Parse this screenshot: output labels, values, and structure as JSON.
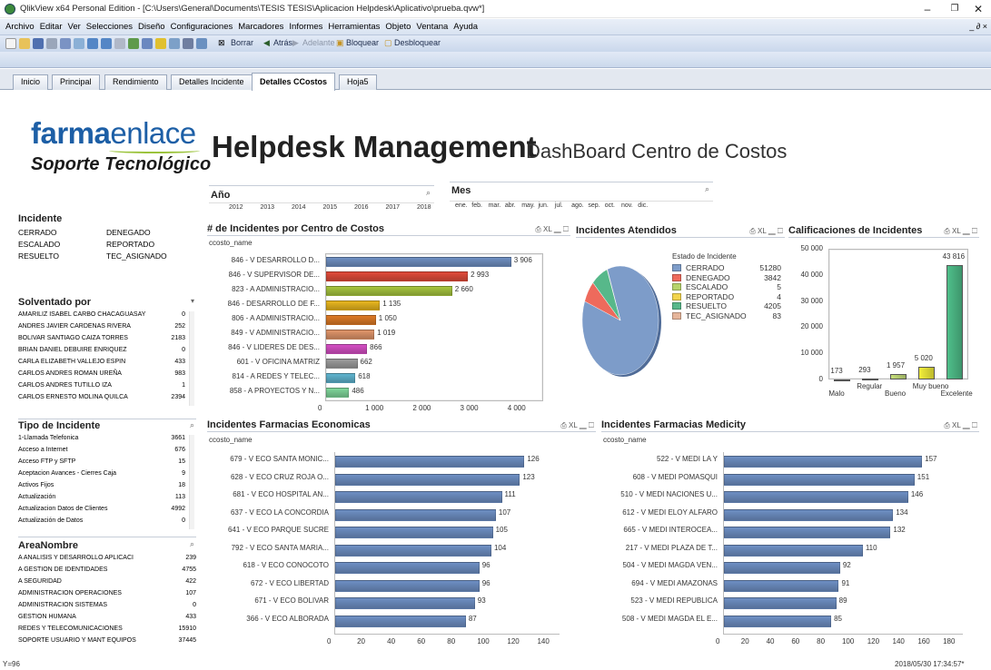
{
  "window": {
    "title": "QlikView x64 Personal Edition - [C:\\Users\\General\\Documents\\TESIS TESIS\\Aplicacion Helpdesk\\Aplicativo\\prueba.qvw*]"
  },
  "menu": [
    "Archivo",
    "Editar",
    "Ver",
    "Selecciones",
    "Diseño",
    "Configuraciones",
    "Marcadores",
    "Informes",
    "Herramientas",
    "Objeto",
    "Ventana",
    "Ayuda"
  ],
  "toolbar": {
    "borrar": "Borrar",
    "atras": "Atrás",
    "adelante": "Adelante",
    "bloquear": "Bloquear",
    "desbloquear": "Desbloquear"
  },
  "tabs": [
    "Inicio",
    "Principal",
    "Rendimiento",
    "Detalles Incidente",
    "Detalles CCostos",
    "Hoja5"
  ],
  "logo": {
    "brand_bold": "farma",
    "brand_light": "enlace",
    "tagline": "Soporte Tecnológico"
  },
  "header": {
    "title": "Helpdesk Management",
    "subtitle": "DashBoard Centro de Costos"
  },
  "anio": {
    "label": "Año",
    "values": [
      "2012",
      "2013",
      "2014",
      "2015",
      "2016",
      "2017",
      "2018"
    ]
  },
  "mes": {
    "label": "Mes",
    "values": [
      "ene.",
      "feb.",
      "mar.",
      "abr.",
      "may.",
      "jun.",
      "jul.",
      "ago.",
      "sep.",
      "oct.",
      "nov.",
      "dic."
    ]
  },
  "incidente": {
    "label": "Incidente",
    "values": [
      "CERRADO",
      "DENEGADO",
      "ESCALADO",
      "REPORTADO",
      "RESUELTO",
      "TEC_ASIGNADO"
    ]
  },
  "solventado": {
    "label": "Solventado por",
    "rows": [
      {
        "name": "AMARILIZ ISABEL CARBO CHACAGUASAY",
        "value": "0"
      },
      {
        "name": "ANDRES JAVIER CARDENAS RIVERA",
        "value": "252"
      },
      {
        "name": "BOLIVAR SANTIAGO CAIZA TORRES",
        "value": "2183"
      },
      {
        "name": "BRIAN DANIEL DEBUIRE ENRIQUEZ",
        "value": "0"
      },
      {
        "name": "CARLA ELIZABETH VALLEJO ESPIN",
        "value": "433"
      },
      {
        "name": "CARLOS ANDRES ROMAN UREÑA",
        "value": "983"
      },
      {
        "name": "CARLOS ANDRES TUTILLO IZA",
        "value": "1"
      },
      {
        "name": "CARLOS ERNESTO MOLINA QUILCA",
        "value": "2394"
      }
    ]
  },
  "tipo": {
    "label": "Tipo de Incidente",
    "rows": [
      {
        "name": "1-Llamada Telefonica",
        "value": "3661"
      },
      {
        "name": "Acceso a Internet",
        "value": "676"
      },
      {
        "name": "Acceso FTP y SFTP",
        "value": "15"
      },
      {
        "name": "Aceptacion Avances - Cierres Caja",
        "value": "9"
      },
      {
        "name": "Activos Fijos",
        "value": "18"
      },
      {
        "name": "Actualización",
        "value": "113"
      },
      {
        "name": "Actualizacion Datos de Clientes",
        "value": "4992"
      },
      {
        "name": "Actualización de Datos",
        "value": "0"
      }
    ]
  },
  "area": {
    "label": "AreaNombre",
    "rows": [
      {
        "name": "A ANALISIS Y DESARROLLO APLICACI",
        "value": "239"
      },
      {
        "name": "A GESTION DE IDENTIDADES",
        "value": "4755"
      },
      {
        "name": "A SEGURIDAD",
        "value": "422"
      },
      {
        "name": "ADMINISTRACION OPERACIONES",
        "value": "107"
      },
      {
        "name": "ADMINISTRACION SISTEMAS",
        "value": "0"
      },
      {
        "name": "GESTION HUMANA",
        "value": "433"
      },
      {
        "name": "REDES Y TELECOMUNICACIONES",
        "value": "15910"
      },
      {
        "name": "SOPORTE USUARIO Y MANT EQUIPOS",
        "value": "37445"
      }
    ]
  },
  "chart_data": [
    {
      "type": "bar",
      "orientation": "horizontal",
      "title": "# de Incidentes por Centro de Costos",
      "dim_label": "ccosto_name",
      "categories": [
        "846 - V DESARROLLO D...",
        "846 - V SUPERVISOR DE...",
        "823 - A ADMINISTRACIO...",
        "846 - DESARROLLO DE F...",
        "806 - A ADMINISTRACIO...",
        "849 - V ADMINISTRACIO...",
        "846 - V LIDERES DE DES...",
        "601 - V OFICINA MATRIZ",
        "814 - A REDES Y TELEC...",
        "858 - A PROYECTOS Y N..."
      ],
      "values": [
        3906,
        2993,
        2660,
        1135,
        1050,
        1019,
        866,
        662,
        618,
        486
      ],
      "value_labels": [
        "3 906",
        "2 993",
        "2 660",
        "1 135",
        "1 050",
        "1 019",
        "866",
        "662",
        "618",
        "486"
      ],
      "colors": [
        "#6f8fc2",
        "#e04b3a",
        "#a7c53f",
        "#e8b61f",
        "#de7a27",
        "#e0956a",
        "#d54fc4",
        "#9c9c9c",
        "#5fb4cf",
        "#7fd69a"
      ],
      "xlim": [
        0,
        4600
      ],
      "ticks": [
        "0",
        "1 000",
        "2 000",
        "3 000",
        "4 000"
      ]
    },
    {
      "type": "pie",
      "title": "Incidentes Atendidos",
      "legend_title": "Estado de Incidente",
      "labels": [
        "CERRADO",
        "DENEGADO",
        "ESCALADO",
        "REPORTADO",
        "RESUELTO",
        "TEC_ASIGNADO"
      ],
      "values": [
        51280,
        3842,
        5,
        4,
        4205,
        83
      ],
      "colors": [
        "#7d9cc9",
        "#ee6a5c",
        "#b6d36a",
        "#f2d44c",
        "#57b88a",
        "#e6b59a"
      ]
    },
    {
      "type": "bar",
      "title": "Calificaciones de Incidentes",
      "categories": [
        "Malo",
        "Regular",
        "Bueno",
        "Muy bueno",
        "Excelente"
      ],
      "values": [
        173,
        293,
        1957,
        5020,
        43816
      ],
      "value_labels": [
        "173",
        "293",
        "1 957",
        "5 020",
        "43 816"
      ],
      "colors": [
        "#c1392b",
        "#ddd87c",
        "#c7e07b",
        "#f2ee3a",
        "#4fbf8a"
      ],
      "ylim": [
        0,
        50000
      ],
      "yticks": [
        "0",
        "10 000",
        "20 000",
        "30 000",
        "40 000",
        "50 000"
      ]
    },
    {
      "type": "bar",
      "orientation": "horizontal",
      "title": "Incidentes Farmacias Economicas",
      "dim_label": "ccosto_name",
      "categories": [
        "679 - V ECO SANTA MONIC...",
        "628 - V ECO CRUZ ROJA O...",
        "681 - V ECO HOSPITAL AN...",
        "637 - V ECO LA CONCORDIA",
        "641 - V ECO PARQUE SUCRE",
        "792 - V ECO SANTA MARIA...",
        "618 - V ECO CONOCOTO",
        "672 - V ECO LIBERTAD",
        "671 - V ECO BOLIVAR",
        "366 - V ECO ALBORADA"
      ],
      "values": [
        126,
        123,
        111,
        107,
        105,
        104,
        96,
        96,
        93,
        87
      ],
      "xlim": [
        0,
        150
      ],
      "ticks": [
        "0",
        "20",
        "40",
        "60",
        "80",
        "100",
        "120",
        "140"
      ]
    },
    {
      "type": "bar",
      "orientation": "horizontal",
      "title": "Incidentes Farmacias Medicity",
      "dim_label": "ccosto_name",
      "categories": [
        "522 - V MEDI LA Y",
        "608 - V MEDI POMASQUI",
        "510 - V MEDI NACIONES U...",
        "612 - V MEDI ELOY ALFARO",
        "665 - V MEDI INTEROCEA...",
        "217 - V MEDI PLAZA DE T...",
        "504 - V MEDI MAGDA VEN...",
        "694 - V MEDI AMAZONAS",
        "523 - V MEDI REPUBLICA",
        "508 - V MEDI MAGDA EL E..."
      ],
      "values": [
        157,
        151,
        146,
        134,
        132,
        110,
        92,
        91,
        89,
        85
      ],
      "xlim": [
        0,
        190
      ],
      "ticks": [
        "0",
        "20",
        "40",
        "60",
        "80",
        "100",
        "120",
        "140",
        "160",
        "180"
      ]
    }
  ],
  "status": {
    "left": "Y=96",
    "right": "2018/05/30 17:34:57*"
  }
}
